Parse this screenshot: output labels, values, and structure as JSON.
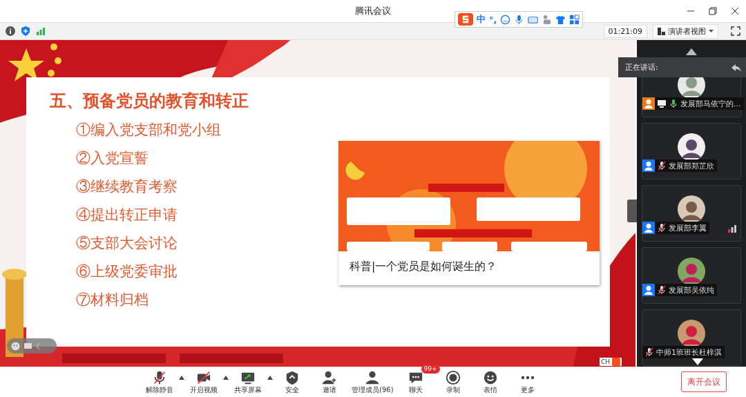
{
  "window": {
    "title": "腾讯会议"
  },
  "info_bar": {
    "timer": "01:21:09",
    "view_mode": "演讲者视图"
  },
  "ime_toolbar": {
    "label": "中",
    "punctuation": "°,"
  },
  "shared_screen": {
    "slide": {
      "title": "五、预备党员的教育和转正",
      "items": [
        "①编入党支部和党小组",
        "②入党宣誓",
        "③继续教育考察",
        "④提出转正申请",
        "⑤支部大会讨论",
        "⑥上级党委审批",
        "⑦材料归档"
      ],
      "card": {
        "kind": "picture",
        "caption": "科普|一个党员是如何诞生的？"
      }
    },
    "ime_indicator": "CH"
  },
  "speaking_bar": {
    "label": "正在讲话:"
  },
  "participants": [
    {
      "name": "发展部马依宁的...",
      "color": "#f07a1a",
      "muted": false,
      "sharing": true,
      "weak_signal": false
    },
    {
      "name": "发展部郑芷欣",
      "color": "#1677ff",
      "muted": true,
      "sharing": false,
      "weak_signal": false
    },
    {
      "name": "发展部李翼",
      "color": "#1677ff",
      "muted": true,
      "sharing": false,
      "weak_signal": true
    },
    {
      "name": "发展部吴依纯",
      "color": "#1677ff",
      "muted": true,
      "sharing": false,
      "weak_signal": false
    },
    {
      "name": "中师1班班长杜梓淇",
      "muted": true,
      "sharing": false,
      "weak_signal": false
    }
  ],
  "toolbar": [
    {
      "kind": "mic",
      "label": "解除静音",
      "caret": true
    },
    {
      "kind": "video",
      "label": "开启视频",
      "caret": true
    },
    {
      "kind": "share",
      "label": "共享屏幕",
      "caret": true
    },
    {
      "kind": "security",
      "label": "安全",
      "caret": false
    },
    {
      "kind": "invite",
      "label": "邀请",
      "caret": false
    },
    {
      "kind": "members",
      "label": "管理成员(96)",
      "caret": false
    },
    {
      "kind": "chat",
      "label": "聊天",
      "caret": false,
      "badge": "99+"
    },
    {
      "kind": "record",
      "label": "录制",
      "caret": false
    },
    {
      "kind": "emoji",
      "label": "表情",
      "caret": false
    },
    {
      "kind": "more",
      "label": "更多",
      "caret": false
    }
  ],
  "leave_button": "离开会议"
}
